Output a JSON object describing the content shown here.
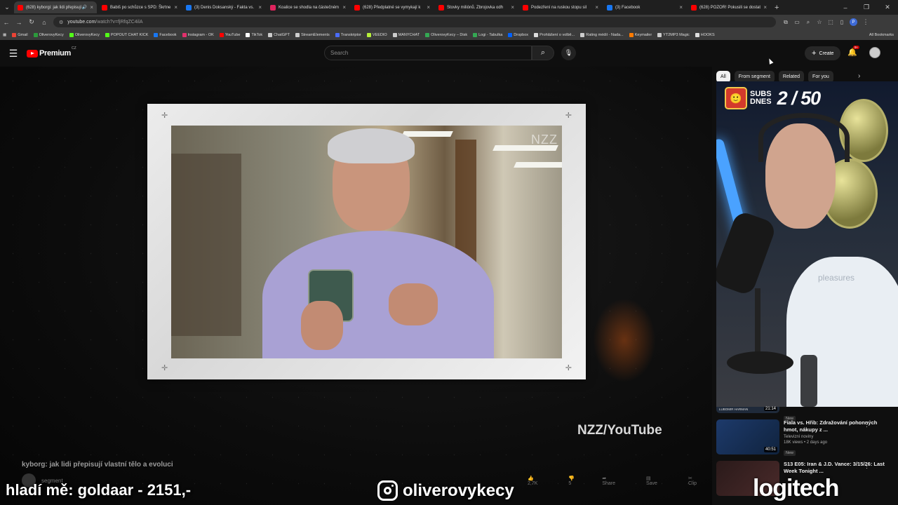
{
  "browser": {
    "tabs": [
      {
        "title": "(628) kyborgi: jak lidi přepisují",
        "active": true,
        "color": "#ff0000"
      },
      {
        "title": "Babiš po schůzce s SPD: Škrtne",
        "active": false,
        "color": "#ff0000"
      },
      {
        "title": "(3) Denis Doksanský - Fakta vs.",
        "active": false,
        "color": "#1877f2"
      },
      {
        "title": "Koalice se shodla na částečném",
        "active": false,
        "color": "#e0245e"
      },
      {
        "title": "(628) Předplatné se vymykají k",
        "active": false,
        "color": "#ff0000"
      },
      {
        "title": "Stovky miliónů. Zbrojovka odh",
        "active": false,
        "color": "#ff0000"
      },
      {
        "title": "Podezření na ruskou stopu sil",
        "active": false,
        "color": "#ff0000"
      },
      {
        "title": "(3) Facebook",
        "active": false,
        "color": "#1877f2"
      },
      {
        "title": "(628) POZOR! Pokusili se dostat",
        "active": false,
        "color": "#ff0000"
      }
    ],
    "url_host": "youtube.com",
    "url_path": "/watch?v=fjRfqZC4ilA",
    "bookmarks": [
      {
        "label": "Gmail",
        "color": "#ea4335"
      },
      {
        "label": "OliverovyKecy",
        "color": "#2b9a3b"
      },
      {
        "label": "OliverovyKecy",
        "color": "#53fc18"
      },
      {
        "label": "POPOUT CHAT KICK",
        "color": "#53fc18"
      },
      {
        "label": "Facebook",
        "color": "#1877f2"
      },
      {
        "label": "Instagram - OK",
        "color": "#e1306c"
      },
      {
        "label": "YouTube",
        "color": "#ff0000"
      },
      {
        "label": "TikTok",
        "color": "#ffffff"
      },
      {
        "label": "ChatGPT",
        "color": "#cccccc"
      },
      {
        "label": "StreamElements",
        "color": "#cccccc"
      },
      {
        "label": "Transkriptor",
        "color": "#4a6cf7"
      },
      {
        "label": "VEEDIO",
        "color": "#b6f03a"
      },
      {
        "label": "MANYCHAT",
        "color": "#cccccc"
      },
      {
        "label": "OliverovyKecy – Disk",
        "color": "#34a853"
      },
      {
        "label": "Logi - Tabulka",
        "color": "#34a853"
      },
      {
        "label": "Dropbox",
        "color": "#0061ff"
      },
      {
        "label": "Prohlášení o volbě...",
        "color": "#dddddd"
      },
      {
        "label": "Rating médií - Nada...",
        "color": "#cccccc"
      },
      {
        "label": "Keymailer",
        "color": "#ff7a00"
      },
      {
        "label": "YT2MP3 Magic",
        "color": "#cccccc"
      },
      {
        "label": "HOOKS",
        "color": "#dddddd"
      }
    ],
    "all_bookmarks": "All Bookmarks",
    "profile_initial": "P"
  },
  "youtube": {
    "brand": "Premium",
    "region": "CZ",
    "search_placeholder": "Search",
    "create_label": "Create",
    "notifications": "9+"
  },
  "video": {
    "corner_watermark": "NZZ",
    "source_label": "NZZ/YouTube",
    "title": "kyborg: jak lidi přepisují vlastní tělo a evoluci",
    "channel": "segment",
    "actions": [
      "2,7K",
      "5",
      "Share",
      "Save",
      "Clip",
      "···"
    ]
  },
  "sidebar": {
    "chips": [
      {
        "label": "All",
        "active": true
      },
      {
        "label": "From segment",
        "active": false
      },
      {
        "label": "Related",
        "active": false
      },
      {
        "label": "For you",
        "active": false
      }
    ],
    "partial_item": {
      "channel": "LUBOMIR HARMAN",
      "duration": "21:14",
      "badge": "New"
    },
    "recommendations": [
      {
        "title": "Fiala vs. Hřib: Zdražování pohonných hmot, nákupy z ...",
        "channel": "Televizní noviny",
        "meta": "18K views • 2 days ago",
        "badge": "New",
        "duration": "40:51"
      },
      {
        "title": "S13 E05: Iran & J.D. Vance: 3/15/26: Last Week Tonight ...",
        "channel": "",
        "meta": "",
        "badge": "",
        "duration": ""
      }
    ]
  },
  "webcam": {
    "subs_label_line1": "SUBS",
    "subs_label_line2": "DNES",
    "subs_count": "2 / 50",
    "shirt_text": "pleasures"
  },
  "overlay": {
    "left_text": "hladí mě: goldaar - 2151,-",
    "instagram_handle": "oliverovykecy",
    "sponsor": "logitech"
  }
}
